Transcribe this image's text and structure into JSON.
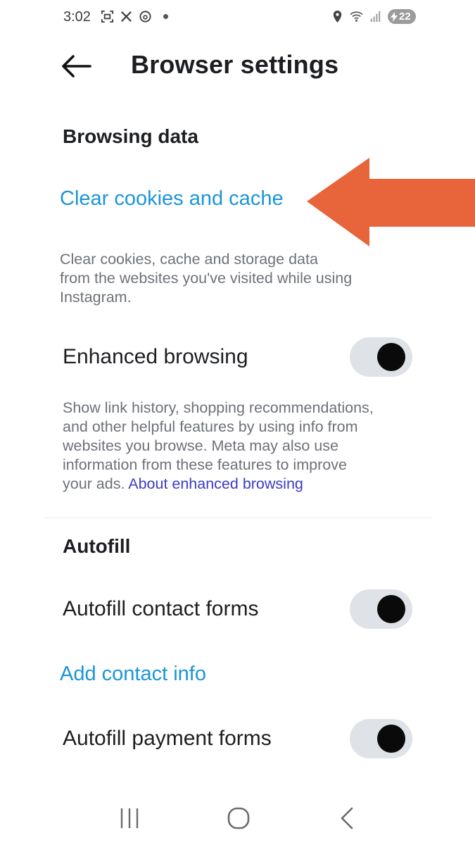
{
  "status_bar": {
    "time": "3:02",
    "left_icons": [
      "screenshot-icon",
      "x-icon",
      "threads-icon"
    ],
    "right_icons": [
      "location-icon",
      "wifi-icon",
      "signal-icon"
    ],
    "battery": "22"
  },
  "header": {
    "title": "Browser settings"
  },
  "browsing_data": {
    "section_title": "Browsing data",
    "clear_link": "Clear cookies and cache",
    "clear_desc": [
      "Clear cookies, cache and storage data",
      "from the websites you've visited while using",
      "Instagram."
    ]
  },
  "enhanced": {
    "label": "Enhanced browsing",
    "enabled": true,
    "desc_lines": [
      "Show link history, shopping recommendations,",
      "and other helpful features by using info from",
      "websites you browse. Meta may also use",
      "information from these features to improve"
    ],
    "desc_last": "your ads.",
    "about_link": "About enhanced browsing"
  },
  "autofill": {
    "section_title": "Autofill",
    "contact_label": "Autofill contact forms",
    "contact_enabled": true,
    "add_contact": "Add contact info",
    "payment_label": "Autofill payment forms",
    "payment_enabled": true
  },
  "annotation": {
    "arrow_color": "#e8643b"
  },
  "colors": {
    "link": "#1b95d8",
    "inline_link": "#3b3cc4",
    "toggle_track": "#dfe2e6"
  }
}
